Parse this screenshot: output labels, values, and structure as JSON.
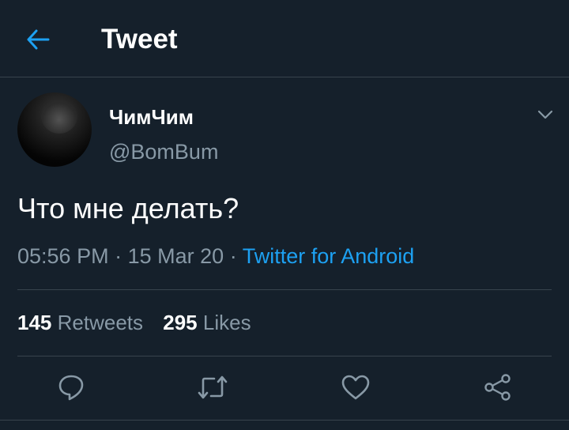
{
  "header": {
    "title": "Tweet",
    "back_icon": "arrow-left-icon",
    "accent_color": "#1da1f2"
  },
  "tweet": {
    "author": {
      "display_name": "ЧимЧим",
      "handle": "@BomBum"
    },
    "text": "Что мне делать?",
    "time": "05:56 PM",
    "date": "15 Mar 20",
    "separator": "·",
    "source": "Twitter for Android",
    "stats": {
      "retweets_count": "145",
      "retweets_label": "Retweets",
      "likes_count": "295",
      "likes_label": "Likes"
    },
    "actions": [
      {
        "name": "reply",
        "icon": "reply-icon"
      },
      {
        "name": "retweet",
        "icon": "retweet-icon"
      },
      {
        "name": "like",
        "icon": "heart-icon"
      },
      {
        "name": "share",
        "icon": "share-icon"
      }
    ]
  },
  "colors": {
    "background": "#15202b",
    "divider": "#38444d",
    "secondary_text": "#8899a6",
    "link": "#1da1f2"
  }
}
